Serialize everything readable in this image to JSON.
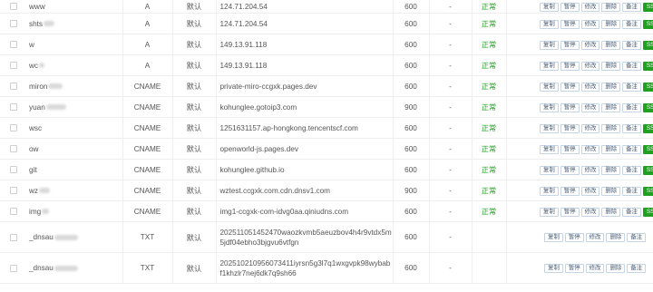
{
  "records": [
    {
      "host": "www",
      "type": "A",
      "line": "默认",
      "value": "124.71.204.54",
      "ttl": "600",
      "mx": "-",
      "status": "正常",
      "ssl": true
    },
    {
      "host": "shts",
      "type": "A",
      "line": "默认",
      "value": "124.71.204.54",
      "ttl": "600",
      "mx": "-",
      "status": "正常",
      "ssl": true
    },
    {
      "host": "w",
      "type": "A",
      "line": "默认",
      "value": "149.13.91.118",
      "ttl": "600",
      "mx": "-",
      "status": "正常",
      "ssl": true
    },
    {
      "host": "wc",
      "type": "A",
      "line": "默认",
      "value": "149.13.91.118",
      "ttl": "600",
      "mx": "-",
      "status": "正常",
      "ssl": true
    },
    {
      "host": "miron",
      "type": "CNAME",
      "line": "默认",
      "value": "private-miro-ccgxk.pages.dev",
      "ttl": "600",
      "mx": "-",
      "status": "正常",
      "ssl": true
    },
    {
      "host": "yuan",
      "type": "CNAME",
      "line": "默认",
      "value": "kohunglee.gotoip3.com",
      "ttl": "900",
      "mx": "-",
      "status": "正常",
      "ssl": true
    },
    {
      "host": "wsc",
      "type": "CNAME",
      "line": "默认",
      "value": "1251631157.ap-hongkong.tencentscf.com",
      "ttl": "600",
      "mx": "-",
      "status": "正常",
      "ssl": true
    },
    {
      "host": "ow",
      "type": "CNAME",
      "line": "默认",
      "value": "openworld-js.pages.dev",
      "ttl": "600",
      "mx": "-",
      "status": "正常",
      "ssl": true
    },
    {
      "host": "git",
      "type": "CNAME",
      "line": "默认",
      "value": "kohunglee.github.io",
      "ttl": "600",
      "mx": "-",
      "status": "正常",
      "ssl": true
    },
    {
      "host": "wz",
      "type": "CNAME",
      "line": "默认",
      "value": "wztest.ccgxk.com.cdn.dnsv1.com",
      "ttl": "900",
      "mx": "-",
      "status": "正常",
      "ssl": true
    },
    {
      "host": "img",
      "type": "CNAME",
      "line": "默认",
      "value": "img1-ccgxk-com-idvg0aa.qiniudns.com",
      "ttl": "600",
      "mx": "-",
      "status": "正常",
      "ssl": true
    },
    {
      "host": "_dnsau",
      "type": "TXT",
      "line": "默认",
      "value": "202511051452470waozkvmb5aeuzbov4h4r9vtdx5m5jdf04ebho3bjgvu6vtfgn",
      "ttl": "600",
      "mx": "-",
      "status": "",
      "ssl": false
    },
    {
      "host": "_dnsau",
      "type": "TXT",
      "line": "默认",
      "value": "202510210956073411iyrsn5g3l7q1wxgvpk98wybabf1khzlr7nej6dk7q9sh66",
      "ttl": "600",
      "mx": "-",
      "status": "",
      "ssl": false
    }
  ],
  "buttons": {
    "copy": "复制",
    "pause": "暂停",
    "edit": "修改",
    "delete": "删除",
    "note": "备注",
    "ssl": "SSL申请"
  }
}
